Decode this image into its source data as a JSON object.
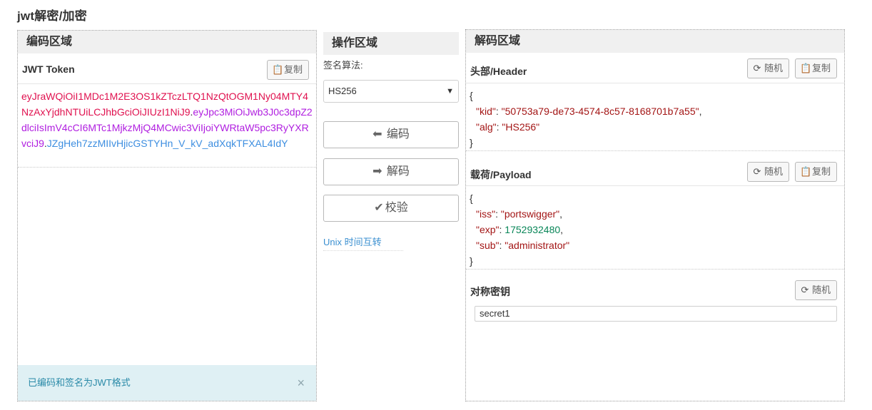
{
  "page": {
    "title": "jwt解密/加密"
  },
  "encode_panel": {
    "heading": "编码区域",
    "token_label": "JWT Token",
    "copy_label": "复制",
    "token": {
      "header": "eyJraWQiOiI1MDc1M2E3OS1kZTczLTQ1NzQtOGM1Ny04MTY4NzAxYjdhNTUiLCJhbGciOiJIUzI1NiJ9",
      "payload": "eyJpc3MiOiJwb3J0c3dpZ2dlciIsImV4cCI6MTc1MjkzMjQ4MCwic3ViIjoiYWRtaW5pc3RyYXRvciJ9",
      "signature": "JZgHeh7zzMIIvHjicGSTYHn_V_kV_adXqkTFXAL4IdY",
      "dot": "."
    },
    "alert": {
      "text": "已编码和签名为JWT格式",
      "close": "×"
    }
  },
  "ops_panel": {
    "heading": "操作区域",
    "alg_label": "签名算法:",
    "alg_selected": "HS256",
    "encode_label": "编码",
    "decode_label": "解码",
    "verify_label": "校验",
    "unix_link": "Unix 时间互转"
  },
  "decode_panel": {
    "heading": "解码区域",
    "header_label": "头部/Header",
    "payload_label": "载荷/Payload",
    "secret_label": "对称密钥",
    "random_label": "随机",
    "copy_label": "复制",
    "header_json": {
      "open": "{",
      "close": "}",
      "kid_key": "\"kid\"",
      "kid_val": "\"50753a79-de73-4574-8c57-8168701b7a55\"",
      "alg_key": "\"alg\"",
      "alg_val": "\"HS256\""
    },
    "payload_json": {
      "open": "{",
      "close": "}",
      "iss_key": "\"iss\"",
      "iss_val": "\"portswigger\"",
      "exp_key": "\"exp\"",
      "exp_val": "1752932480",
      "sub_key": "\"sub\"",
      "sub_val": "\"administrator\""
    },
    "secret_value": "secret1"
  },
  "icons": {
    "copy": "clipboard-icon",
    "random": "refresh-icon",
    "encode": "arrow-left-icon",
    "decode": "arrow-right-icon",
    "verify": "checkmark-icon",
    "close": "close-icon",
    "select": "chevron-down-icon"
  },
  "colors": {
    "token_header": "#e0114f",
    "token_payload": "#b01ee0",
    "token_signature": "#3d8ee0",
    "json_string": "#a31515",
    "json_number": "#098658",
    "alert_bg": "#dff0f4",
    "link": "#3a8fd0"
  }
}
